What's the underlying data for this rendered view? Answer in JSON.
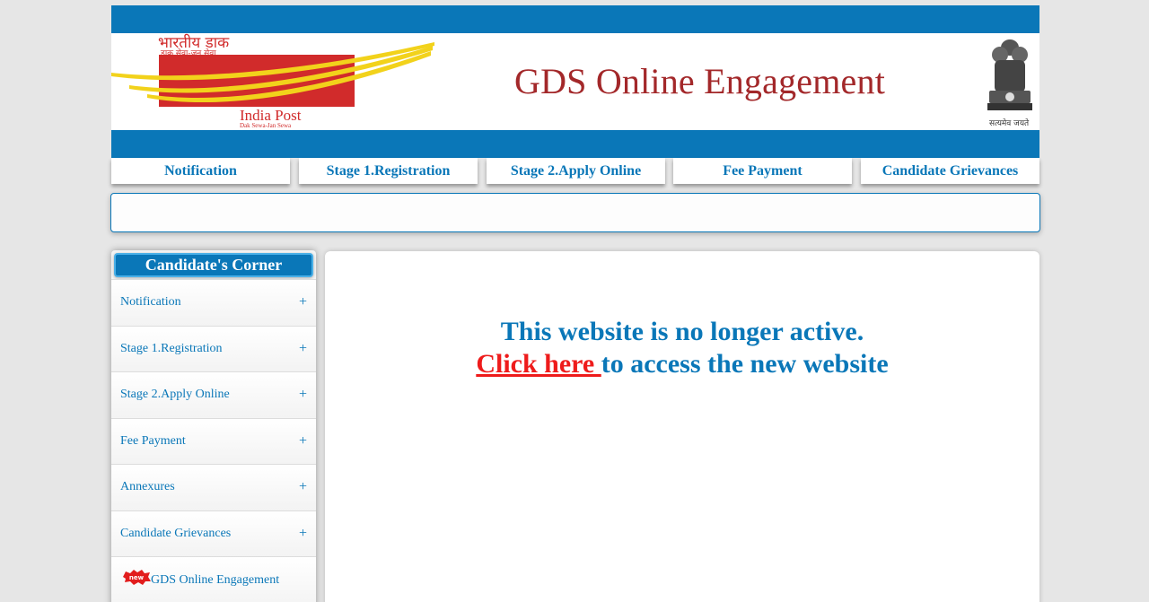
{
  "header": {
    "logo_hindi": "भारतीय डाक",
    "logo_hindi_sub": "डाक सेवा-जन सेवा",
    "logo_english": "India Post",
    "logo_english_sub": "Dak Sewa-Jan Sewa",
    "title": "GDS Online Engagement",
    "emblem_motto": "सत्यमेव जयते"
  },
  "nav": {
    "items": [
      {
        "label": "Notification"
      },
      {
        "label": "Stage 1.Registration"
      },
      {
        "label": "Stage 2.Apply Online"
      },
      {
        "label": "Fee Payment"
      },
      {
        "label": "Candidate Grievances"
      }
    ]
  },
  "sidebar": {
    "title": "Candidate's Corner",
    "items": [
      {
        "label": "Notification",
        "expand": "+"
      },
      {
        "label": "Stage 1.Registration",
        "expand": "+"
      },
      {
        "label": "Stage 2.Apply Online",
        "expand": "+"
      },
      {
        "label": "Fee Payment",
        "expand": "+"
      },
      {
        "label": "Annexures",
        "expand": "+"
      },
      {
        "label": "Candidate Grievances",
        "expand": "+"
      }
    ],
    "new_badge": "new",
    "last_item": "GDS Online Engagement"
  },
  "main": {
    "line1": "This website is no longer active.",
    "link_text": "Click here ",
    "line2_rest": "to access the new website"
  },
  "colors": {
    "brand_blue": "#0a77b8",
    "title_red": "#a3282a",
    "link_red": "#ee1b1b",
    "logo_red": "#d12b2b",
    "logo_yellow": "#f2d21b"
  }
}
